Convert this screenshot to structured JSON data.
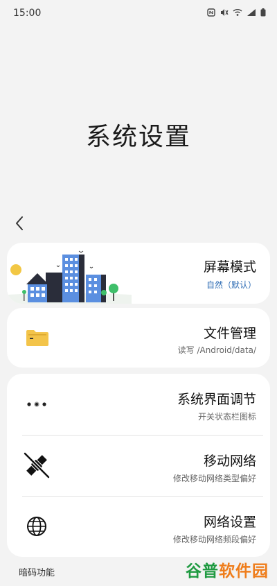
{
  "status_bar": {
    "time": "15:00",
    "icons": [
      "nfc-icon",
      "mute-icon",
      "wifi-icon",
      "signal-icon",
      "battery-icon"
    ]
  },
  "page": {
    "title": "系统设置",
    "back_icon": "chevron-left-icon"
  },
  "items": [
    {
      "title": "屏幕模式",
      "subtitle": "自然（默认）",
      "icon": "city-illustration"
    },
    {
      "title": "文件管理",
      "subtitle": "读写 /Android/data/",
      "icon": "folder-icon"
    },
    {
      "title": "系统界面调节",
      "subtitle": "开关状态栏图标",
      "icon": "dots-icon"
    },
    {
      "title": "移动网络",
      "subtitle": "修改移动网络类型偏好",
      "icon": "satellite-off-icon"
    },
    {
      "title": "网络设置",
      "subtitle": "修改移动网络频段偏好",
      "icon": "globe-icon"
    }
  ],
  "section": {
    "label": "暗码功能"
  },
  "watermark": {
    "part1": "谷普",
    "part2": "软件园"
  },
  "colors": {
    "background": "#f3f3f3",
    "card": "#ffffff",
    "accent_subtitle": "#2f6db5",
    "folder": "#f3c44a"
  }
}
